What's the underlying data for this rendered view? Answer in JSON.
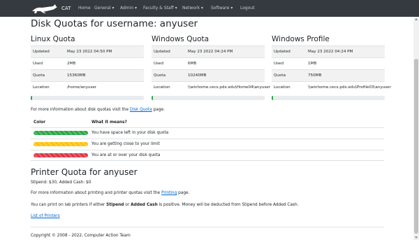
{
  "nav": {
    "brand": "CAT",
    "items": [
      {
        "label": "Home"
      },
      {
        "label": "General ▾"
      },
      {
        "label": "Admin ▾"
      },
      {
        "label": "Faculty & Staff ▾"
      },
      {
        "label": "Network ▾"
      },
      {
        "label": "Software ▾"
      },
      {
        "label": "Logout"
      }
    ]
  },
  "page_title": "Disk Quotas for username: anyuser",
  "quotas": [
    {
      "title": "Linux Quota",
      "rows": [
        {
          "label": "Updated",
          "value": "May 23 2022 04:50 PM"
        },
        {
          "label": "Used",
          "value": "2MB"
        },
        {
          "label": "Quota",
          "value": "15360MB"
        },
        {
          "label": "Location",
          "value": "/home/anyuser"
        }
      ],
      "usage_fraction": 0.01
    },
    {
      "title": "Windows Quota",
      "rows": [
        {
          "label": "Updated",
          "value": "May 23 2022 04:24 PM"
        },
        {
          "label": "Used",
          "value": "6MB"
        },
        {
          "label": "Quota",
          "value": "10240MB"
        },
        {
          "label": "Location",
          "value": "\\\\winhome.cecs.pdx.edu\\Home04\\anyuser"
        }
      ],
      "usage_fraction": 0.01
    },
    {
      "title": "Windows Profile",
      "rows": [
        {
          "label": "Updated",
          "value": "May 23 2022 04:24 PM"
        },
        {
          "label": "Used",
          "value": "1MB"
        },
        {
          "label": "Quota",
          "value": "750MB"
        },
        {
          "label": "Location",
          "value": "\\\\winhome.cecs.pdx.edu\\Profile03\\anyuser"
        }
      ],
      "usage_fraction": 0.01
    }
  ],
  "disk_info": {
    "prefix": "For more information about disk quotas visit the ",
    "link": "Disk Quota",
    "suffix": " page."
  },
  "legend": {
    "color_header": "Color",
    "meaning_header": "What it means?",
    "rows": [
      {
        "color": "#28a745",
        "text": "You have space left in your disk quota"
      },
      {
        "color": "#ffc107",
        "text": "You are getting close to your limit"
      },
      {
        "color": "#dc3545",
        "text": "You are at or over your disk quota"
      }
    ]
  },
  "printer": {
    "title": "Printer Quota for anyuser",
    "stipend": "Stipend: $30, Added Cash: $0",
    "info_prefix": "For more information about printing and printer quotas visit the ",
    "info_link": "Printing",
    "info_suffix": " page.",
    "note_1": "You can print on lab printers if either ",
    "note_stipend": "Stipend",
    "note_2": " or ",
    "note_cash": "Added Cash",
    "note_3": " is positive. Money will be deducted from Stipend before Added Cash.",
    "list_link": "List of Printers"
  },
  "footer": "Copyright © 2008 - 2022, Computer Action Team"
}
